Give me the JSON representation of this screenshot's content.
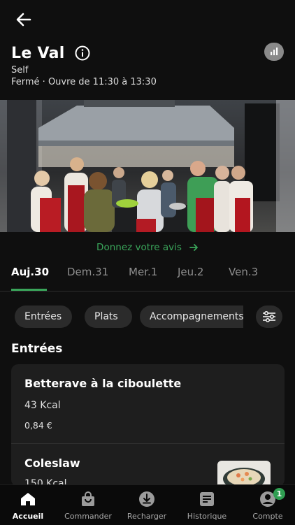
{
  "header": {
    "title": "Le Val",
    "subtitle": "Self",
    "hours": "Fermé · Ouvre de 11:30 à 13:30"
  },
  "review": {
    "label": "Donnez votre avis"
  },
  "days": [
    {
      "label": "Auj.30",
      "active": true
    },
    {
      "label": "Dem.31"
    },
    {
      "label": "Mer.1"
    },
    {
      "label": "Jeu.2"
    },
    {
      "label": "Ven.3"
    }
  ],
  "categories": [
    "Entrées",
    "Plats",
    "Accompagnements"
  ],
  "section": {
    "title": "Entrées"
  },
  "items": [
    {
      "name": "Betterave à la ciboulette",
      "kcal": "43 Kcal",
      "price": "0,84 €"
    },
    {
      "name": "Coleslaw",
      "kcal": "150 Kcal"
    }
  ],
  "nav": [
    {
      "label": "Accueil",
      "icon": "home-icon",
      "active": true
    },
    {
      "label": "Commander",
      "icon": "shopping-bag-icon"
    },
    {
      "label": "Recharger",
      "icon": "download-icon"
    },
    {
      "label": "Historique",
      "icon": "receipt-icon"
    },
    {
      "label": "Compte",
      "icon": "account-icon",
      "badge": "1"
    }
  ],
  "colors": {
    "accent": "#3aa55a",
    "background": "#0f0f0f",
    "card": "#1e1e1e",
    "chip": "#2b2b2b"
  }
}
